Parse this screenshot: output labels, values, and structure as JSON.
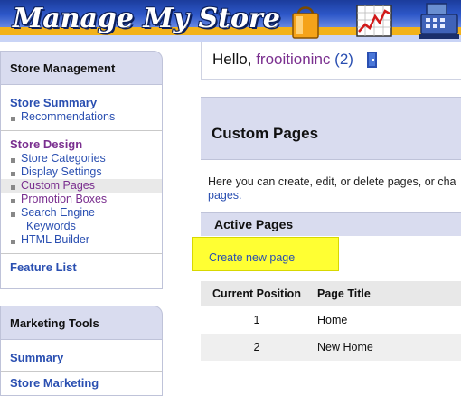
{
  "header": {
    "brand": "Manage My Store",
    "icons": [
      "shopping-bag-icon",
      "sales-chart-icon",
      "cash-register-icon"
    ]
  },
  "sidebar": {
    "store_management": {
      "title": "Store Management",
      "sections": [
        {
          "label": "Store Summary",
          "items": [
            "Recommendations"
          ]
        },
        {
          "label": "Store Design",
          "items": [
            "Store Categories",
            "Display Settings",
            "Custom Pages",
            "Promotion Boxes",
            "Search Engine",
            "Keywords",
            "HTML Builder"
          ],
          "selected": "Custom Pages"
        },
        {
          "label": "Feature List",
          "items": []
        }
      ]
    },
    "marketing_tools": {
      "title": "Marketing Tools",
      "sections": [
        {
          "label": "Summary"
        },
        {
          "label": "Store Marketing"
        }
      ]
    }
  },
  "greeting": {
    "hello": "Hello,",
    "username": "frooitioninc",
    "count": "2"
  },
  "main": {
    "title": "Custom Pages",
    "description_line1": "Here you can create, edit, or delete pages, or cha",
    "description_line2": "pages.",
    "active_pages": "Active Pages",
    "create_link": "Create new page",
    "table": {
      "headers": [
        "Current Position",
        "Page Title"
      ],
      "rows": [
        {
          "position": "1",
          "title": "Home"
        },
        {
          "position": "2",
          "title": "New Home"
        }
      ]
    }
  },
  "colors": {
    "accent_blue": "#2a4fb1",
    "accent_purple": "#7a2f8f",
    "panel": "#d9dcef",
    "highlight": "#ffff33"
  }
}
